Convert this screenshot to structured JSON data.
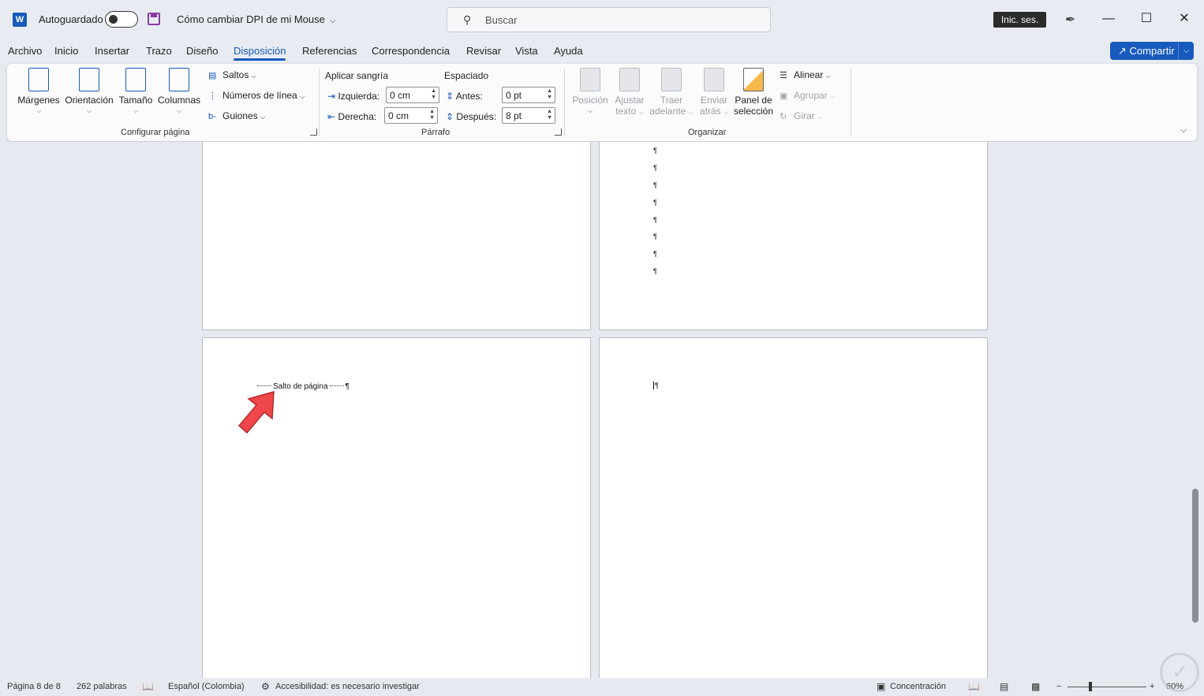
{
  "titlebar": {
    "autosave_label": "Autoguardado",
    "doc_title": "Cómo cambiar DPI de mi Mouse",
    "search_placeholder": "Buscar",
    "signin_label": "Inic. ses.",
    "logo_letter": "W"
  },
  "menu": {
    "tabs": [
      "Archivo",
      "Inicio",
      "Insertar",
      "Trazo",
      "Diseño",
      "Disposición",
      "Referencias",
      "Correspondencia",
      "Revisar",
      "Vista",
      "Ayuda"
    ],
    "active": "Disposición",
    "share_label": "Compartir"
  },
  "ribbon": {
    "page_setup": {
      "margins": "Márgenes",
      "orientation": "Orientación",
      "size": "Tamaño",
      "columns": "Columnas",
      "breaks": "Saltos",
      "line_numbers": "Números de línea",
      "hyphenation": "Guiones",
      "group_label": "Configurar página"
    },
    "paragraph": {
      "indent_header": "Aplicar sangría",
      "spacing_header": "Espaciado",
      "left_label": "Izquierda:",
      "left_value": "0 cm",
      "right_label": "Derecha:",
      "right_value": "0 cm",
      "before_label": "Antes:",
      "before_value": "0 pt",
      "after_label": "Después:",
      "after_value": "8 pt",
      "group_label": "Párrafo"
    },
    "arrange": {
      "position_1": "Posición",
      "wrap_1": "Ajustar",
      "wrap_2": "texto",
      "forward_1": "Traer",
      "forward_2": "adelante",
      "backward_1": "Enviar",
      "backward_2": "atrás",
      "selection_1": "Panel de",
      "selection_2": "selección",
      "align": "Alinear",
      "group": "Agrupar",
      "rotate": "Girar",
      "group_label": "Organizar"
    }
  },
  "document": {
    "pilcrow": "¶",
    "page_break_text": "Salto de página"
  },
  "status": {
    "page": "Página 8 de 8",
    "words": "262 palabras",
    "language": "Español (Colombia)",
    "accessibility": "Accesibilidad: es necesario investigar",
    "focus": "Concentración",
    "zoom": "60%"
  },
  "colors": {
    "accent": "#185abd",
    "arrow": "#f0474a"
  }
}
